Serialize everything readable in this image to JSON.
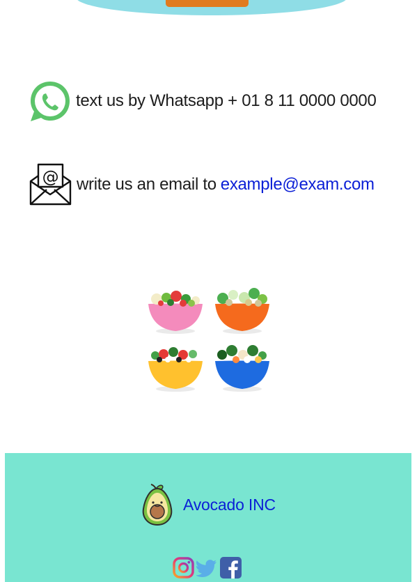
{
  "contact": {
    "whatsapp_text": "text us by Whatsapp + 01 8 11 0000 0000",
    "email_text": "write us an email to",
    "email_address": "example@exam.com"
  },
  "footer": {
    "brand_name": "Avocado INC",
    "social_icons": [
      "instagram-icon",
      "twitter-icon",
      "facebook-icon"
    ]
  },
  "colors": {
    "footer_bg": "#79e5d1",
    "link": "#0b1fd6",
    "whatsapp_green": "#5cc46a",
    "top_accent_orange": "#e07b1f",
    "top_oval": "#8fdde6"
  }
}
